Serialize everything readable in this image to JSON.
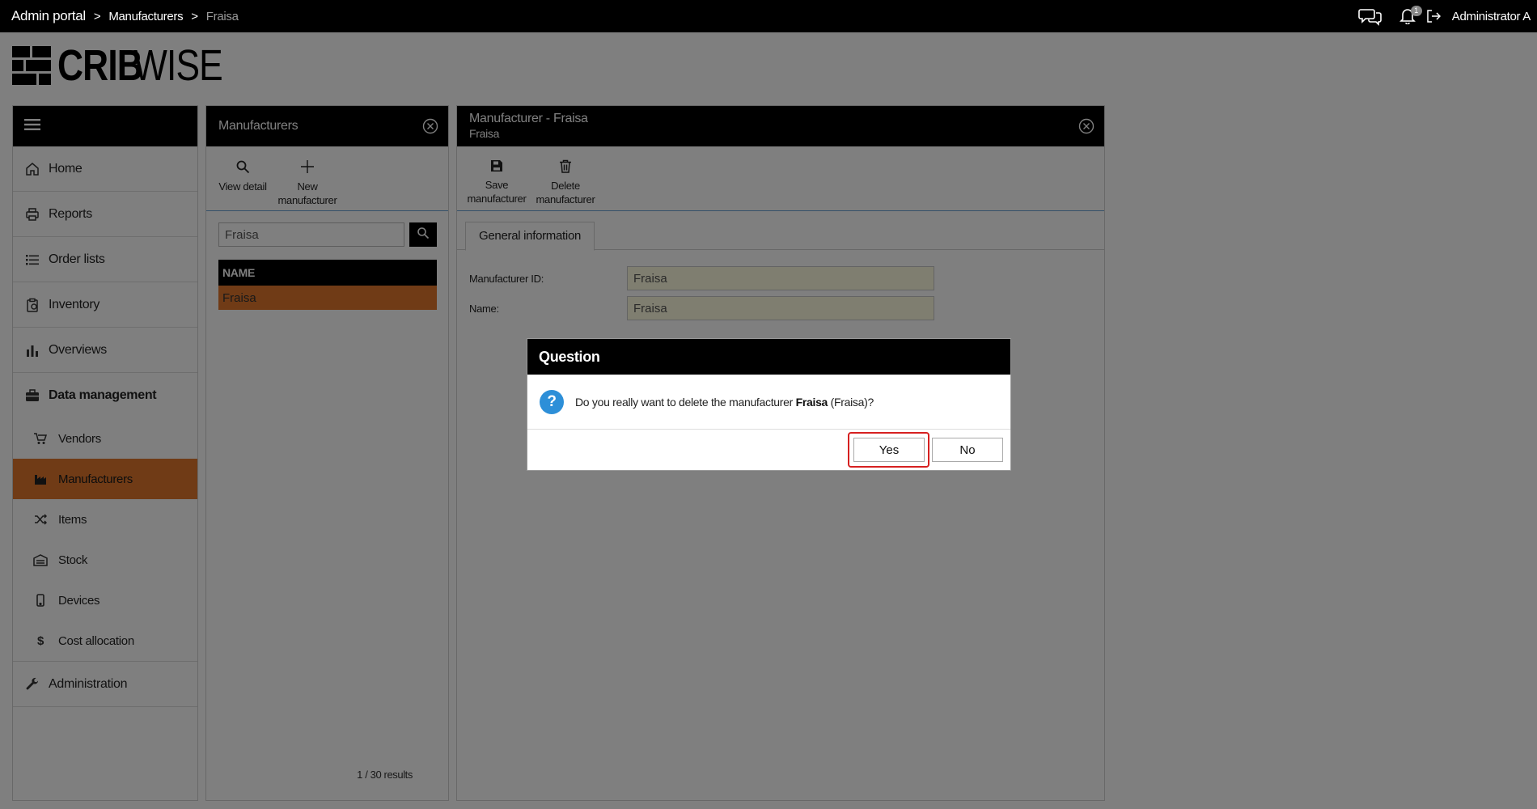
{
  "topbar": {
    "breadcrumb": [
      "Admin portal",
      "Manufacturers",
      "Fraisa"
    ],
    "separator": ">",
    "notification_count": "1",
    "username": "Administrator A"
  },
  "logo": {
    "bold": "CRIB",
    "light": "WISE"
  },
  "sidebar": {
    "items": [
      {
        "label": "Home",
        "icon": "home-icon"
      },
      {
        "label": "Reports",
        "icon": "printer-icon"
      },
      {
        "label": "Order lists",
        "icon": "list-icon"
      },
      {
        "label": "Inventory",
        "icon": "clipboard-icon"
      },
      {
        "label": "Overviews",
        "icon": "bar-chart-icon"
      }
    ],
    "data_management": {
      "label": "Data management",
      "icon": "briefcase-icon",
      "children": [
        {
          "label": "Vendors",
          "icon": "cart-icon"
        },
        {
          "label": "Manufacturers",
          "icon": "factory-icon",
          "active": true
        },
        {
          "label": "Items",
          "icon": "shuffle-icon"
        },
        {
          "label": "Stock",
          "icon": "warehouse-icon"
        },
        {
          "label": "Devices",
          "icon": "mobile-icon"
        },
        {
          "label": "Cost allocation",
          "icon": "dollar-icon"
        }
      ]
    },
    "administration": {
      "label": "Administration",
      "icon": "wrench-icon"
    }
  },
  "list_panel": {
    "title": "Manufacturers",
    "tools": [
      {
        "label": "View detail",
        "icon": "search-icon"
      },
      {
        "label": "New manufacturer",
        "icon": "plus-icon"
      }
    ],
    "search": {
      "value": "Fraisa"
    },
    "column_header": "NAME",
    "rows": [
      "Fraisa"
    ],
    "results": "1 / 30 results"
  },
  "detail_panel": {
    "title": "Manufacturer - Fraisa",
    "subtitle": "Fraisa",
    "tools": [
      {
        "label": "Save manufacturer",
        "icon": "save-icon"
      },
      {
        "label": "Delete manufacturer",
        "icon": "trash-icon"
      }
    ],
    "tab": "General information",
    "fields": [
      {
        "label": "Manufacturer ID:",
        "value": "Fraisa"
      },
      {
        "label": "Name:",
        "value": "Fraisa"
      }
    ]
  },
  "dialog": {
    "title": "Question",
    "message_pre": "Do you really want to delete the manufacturer ",
    "message_bold": "Fraisa",
    "message_post": " (Fraisa)?",
    "yes": "Yes",
    "no": "No",
    "highlight_color": "#d62020"
  },
  "colors": {
    "accent": "#e0772d",
    "header": "#000000",
    "info": "#2d8fd8"
  }
}
